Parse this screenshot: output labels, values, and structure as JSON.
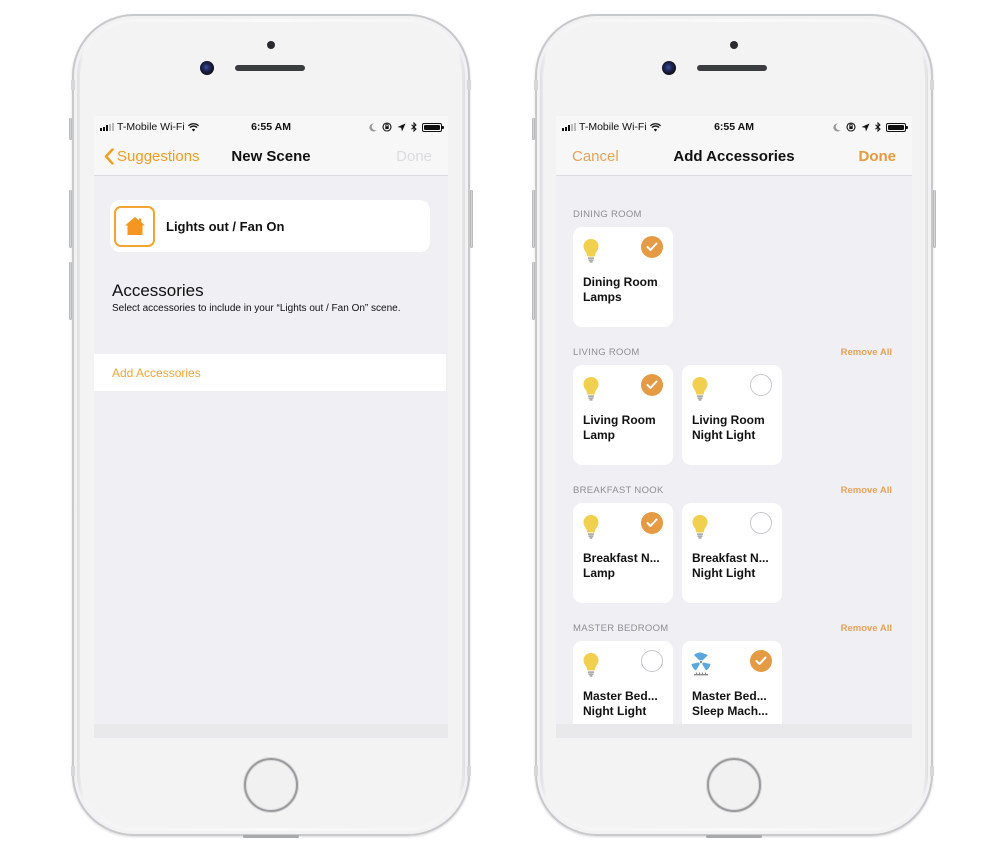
{
  "colors": {
    "accent": "#f4a431",
    "accent_muted": "#e7a259",
    "checkmark": "#e59a44",
    "bulb": "#f1cf4f",
    "fan": "#5aa7e0",
    "screen_bg": "#efeff4",
    "section_label": "#8e8e93"
  },
  "status_bar": {
    "carrier": "T-Mobile Wi-Fi",
    "time": "6:55 AM",
    "icons": [
      "signal-icon",
      "wifi-icon",
      "moon-icon",
      "orientation-lock-icon",
      "location-icon",
      "bluetooth-icon",
      "battery-icon"
    ]
  },
  "left_screen": {
    "nav": {
      "back_label": "Suggestions",
      "title": "New Scene",
      "done_label": "Done",
      "done_enabled": false
    },
    "scene": {
      "icon": "house-icon",
      "name": "Lights out / Fan On"
    },
    "accessories_section": {
      "heading": "Accessories",
      "description": "Select accessories to include in your “Lights out / Fan On” scene."
    },
    "add_accessories_label": "Add Accessories"
  },
  "right_screen": {
    "nav": {
      "cancel_label": "Cancel",
      "title": "Add Accessories",
      "done_label": "Done",
      "done_enabled": true
    },
    "remove_all_label": "Remove All",
    "rooms": [
      {
        "name": "DINING ROOM",
        "show_remove_all": false,
        "accessories": [
          {
            "line1": "Dining Room",
            "line2": "Lamps",
            "icon": "lightbulb-icon",
            "selected": true
          }
        ]
      },
      {
        "name": "LIVING ROOM",
        "show_remove_all": true,
        "accessories": [
          {
            "line1": "Living Room",
            "line2": "Lamp",
            "icon": "lightbulb-icon",
            "selected": true
          },
          {
            "line1": "Living Room",
            "line2": "Night Light",
            "icon": "lightbulb-icon",
            "selected": false
          }
        ]
      },
      {
        "name": "BREAKFAST NOOK",
        "show_remove_all": true,
        "accessories": [
          {
            "line1": "Breakfast N...",
            "line2": "Lamp",
            "icon": "lightbulb-icon",
            "selected": true
          },
          {
            "line1": "Breakfast N...",
            "line2": "Night Light",
            "icon": "lightbulb-icon",
            "selected": false
          }
        ]
      },
      {
        "name": "MASTER BEDROOM",
        "show_remove_all": true,
        "accessories": [
          {
            "line1": "Master Bed...",
            "line2": "Night Light",
            "icon": "lightbulb-icon",
            "selected": false
          },
          {
            "line1": "Master Bed...",
            "line2": "Sleep Mach...",
            "icon": "fan-icon",
            "selected": true
          }
        ]
      }
    ]
  }
}
